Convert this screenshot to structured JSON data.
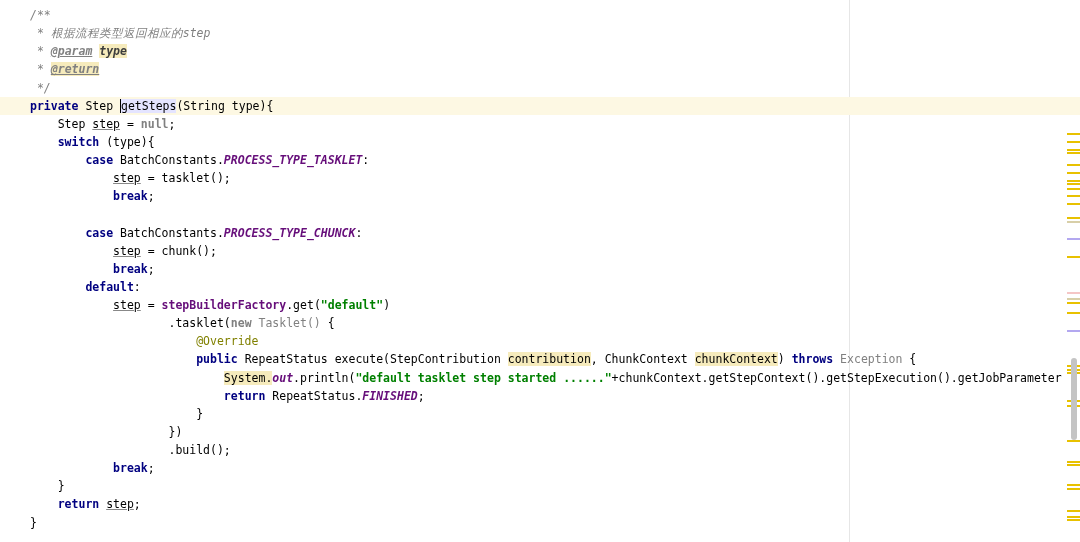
{
  "lines": [
    {
      "current": false,
      "tokens": [
        {
          "text": "/**",
          "kind": "comment"
        }
      ]
    },
    {
      "current": false,
      "tokens": [
        {
          "text": " * 根据流程类型返回相应的step",
          "kind": "comment"
        }
      ]
    },
    {
      "current": false,
      "tokens": [
        {
          "text": " * ",
          "kind": "comment"
        },
        {
          "text": "@param",
          "kind": "doc-tag"
        },
        {
          "text": "type",
          "kind": "doc-param-marked"
        }
      ]
    },
    {
      "current": false,
      "tokens": [
        {
          "text": " * ",
          "kind": "comment"
        },
        {
          "text": "@return",
          "kind": "doc-tag-marked"
        }
      ]
    },
    {
      "current": false,
      "tokens": [
        {
          "text": " */",
          "kind": "comment"
        }
      ]
    },
    {
      "current": true,
      "tokens": [
        {
          "text": "private",
          "kind": "keyword"
        },
        {
          "text": " Step ",
          "kind": "plain"
        },
        {
          "text": "getSteps",
          "kind": "ident"
        },
        {
          "text": "(String type){",
          "kind": "plain"
        }
      ]
    },
    {
      "current": false,
      "tokens": [
        {
          "text": "    Step ",
          "kind": "plain"
        },
        {
          "text": "step",
          "kind": "local"
        },
        {
          "text": " = ",
          "kind": "plain"
        },
        {
          "text": "null",
          "kind": "faded-keyword"
        },
        {
          "text": ";",
          "kind": "plain"
        }
      ]
    },
    {
      "current": false,
      "tokens": [
        {
          "text": "    switch",
          "kind": "keyword"
        },
        {
          "text": " (type){",
          "kind": "plain"
        }
      ]
    },
    {
      "current": false,
      "tokens": [
        {
          "text": "        case",
          "kind": "keyword"
        },
        {
          "text": " BatchConstants.",
          "kind": "plain"
        },
        {
          "text": "PROCESS_TYPE_TASKLET",
          "kind": "constant"
        },
        {
          "text": ":",
          "kind": "plain"
        }
      ]
    },
    {
      "current": false,
      "tokens": [
        {
          "text": "            step",
          "kind": "local"
        },
        {
          "text": " = tasklet();",
          "kind": "plain"
        }
      ]
    },
    {
      "current": false,
      "tokens": [
        {
          "text": "            break",
          "kind": "keyword"
        },
        {
          "text": ";",
          "kind": "plain"
        }
      ]
    },
    {
      "current": false
    },
    {
      "current": false,
      "tokens": [
        {
          "text": "        case",
          "kind": "keyword"
        },
        {
          "text": " BatchConstants.",
          "kind": "plain"
        },
        {
          "text": "PROCESS_TYPE_CHUNCK",
          "kind": "constant"
        },
        {
          "text": ":",
          "kind": "plain"
        }
      ]
    },
    {
      "current": false,
      "tokens": [
        {
          "text": "            step",
          "kind": "local"
        },
        {
          "text": " = chunk();",
          "kind": "plain"
        }
      ]
    },
    {
      "current": false,
      "tokens": [
        {
          "text": "            break",
          "kind": "keyword"
        },
        {
          "text": ";",
          "kind": "plain"
        }
      ]
    },
    {
      "current": false,
      "tokens": [
        {
          "text": "        default",
          "kind": "keyword"
        },
        {
          "text": ":",
          "kind": "plain"
        }
      ]
    },
    {
      "current": false,
      "tokens": [
        {
          "text": "            step",
          "kind": "local"
        },
        {
          "text": " = ",
          "kind": "plain"
        },
        {
          "text": "stepBuilderFactory",
          "kind": "member"
        },
        {
          "text": ".get(",
          "kind": "plain"
        },
        {
          "text": "\"default\"",
          "kind": "string"
        },
        {
          "text": ")",
          "kind": "plain"
        }
      ]
    },
    {
      "current": false,
      "tokens": [
        {
          "text": "                    .tasklet(",
          "kind": "plain"
        },
        {
          "text": "new",
          "kind": "faded-keyword"
        },
        {
          "text": " Tasklet()",
          "kind": "faded"
        },
        {
          "text": " {",
          "kind": "plain"
        }
      ]
    },
    {
      "current": false,
      "tokens": [
        {
          "text": "                        @Override",
          "kind": "annotation"
        }
      ]
    },
    {
      "current": false,
      "tokens": [
        {
          "text": "                        public",
          "kind": "keyword"
        },
        {
          "text": " RepeatStatus execute(StepContribution ",
          "kind": "plain"
        },
        {
          "text": "contribution",
          "kind": "marked"
        },
        {
          "text": ", ChunkContext ",
          "kind": "plain"
        },
        {
          "text": "chunkContext",
          "kind": "marked"
        },
        {
          "text": ") ",
          "kind": "plain"
        },
        {
          "text": "throws",
          "kind": "keyword"
        },
        {
          "text": " Exception",
          "kind": "faded"
        },
        {
          "text": " {",
          "kind": "plain"
        }
      ]
    },
    {
      "current": false,
      "tokens": [
        {
          "text": "                            System.",
          "kind": "marked"
        },
        {
          "text": "out",
          "kind": "static-field"
        },
        {
          "text": ".println(",
          "kind": "plain"
        },
        {
          "text": "\"default tasklet step started ......\"",
          "kind": "string"
        },
        {
          "text": "+chunkContext.getStepContext().getStepExecution().getJobParameter",
          "kind": "plain"
        }
      ]
    },
    {
      "current": false,
      "tokens": [
        {
          "text": "                            return",
          "kind": "keyword"
        },
        {
          "text": " RepeatStatus.",
          "kind": "plain"
        },
        {
          "text": "FINISHED",
          "kind": "constant"
        },
        {
          "text": ";",
          "kind": "plain"
        }
      ]
    },
    {
      "current": false,
      "tokens": [
        {
          "text": "                        }",
          "kind": "plain"
        }
      ]
    },
    {
      "current": false,
      "tokens": [
        {
          "text": "                    })",
          "kind": "plain"
        }
      ]
    },
    {
      "current": false,
      "tokens": [
        {
          "text": "                    .build();",
          "kind": "plain"
        }
      ]
    },
    {
      "current": false,
      "tokens": [
        {
          "text": "            break",
          "kind": "keyword"
        },
        {
          "text": ";",
          "kind": "plain"
        }
      ]
    },
    {
      "current": false,
      "tokens": [
        {
          "text": "    }",
          "kind": "plain"
        }
      ]
    },
    {
      "current": false,
      "tokens": [
        {
          "text": "    return ",
          "kind": "keyword"
        },
        {
          "text": "step",
          "kind": "local"
        },
        {
          "text": ";",
          "kind": "plain"
        }
      ]
    },
    {
      "current": false,
      "tokens": [
        {
          "text": "}",
          "kind": "plain"
        }
      ]
    }
  ]
}
